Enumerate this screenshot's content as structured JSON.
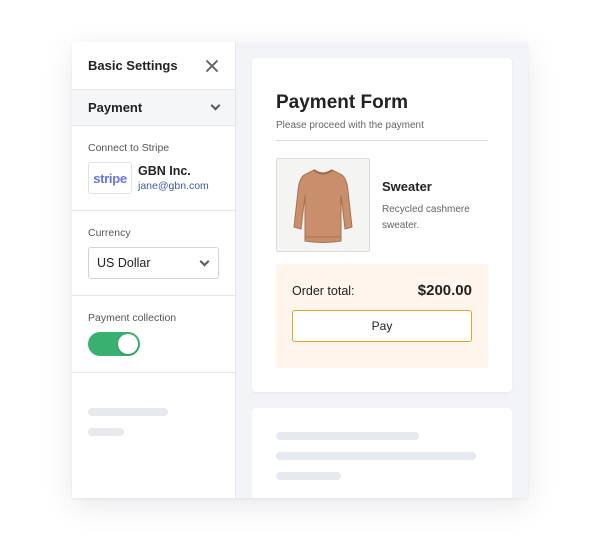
{
  "sidebar": {
    "title": "Basic Settings",
    "section_title": "Payment",
    "connect_label": "Connect to Stripe",
    "stripe_logo": "stripe",
    "company": "GBN Inc.",
    "email": "jane@gbn.com",
    "currency_label": "Currency",
    "currency_value": "US Dollar",
    "collection_label": "Payment collection",
    "collection_enabled": true,
    "toggle_color": "#3ab070"
  },
  "form": {
    "title": "Payment Form",
    "subtitle": "Please proceed with the payment",
    "product": {
      "name": "Sweater",
      "description": "Recycled cashmere sweater.",
      "image_icon": "sweater-icon"
    },
    "order_label": "Order total:",
    "order_total": "$200.00",
    "pay_label": "Pay",
    "accent": "#e0a52a",
    "order_bg": "#fff5ec"
  }
}
